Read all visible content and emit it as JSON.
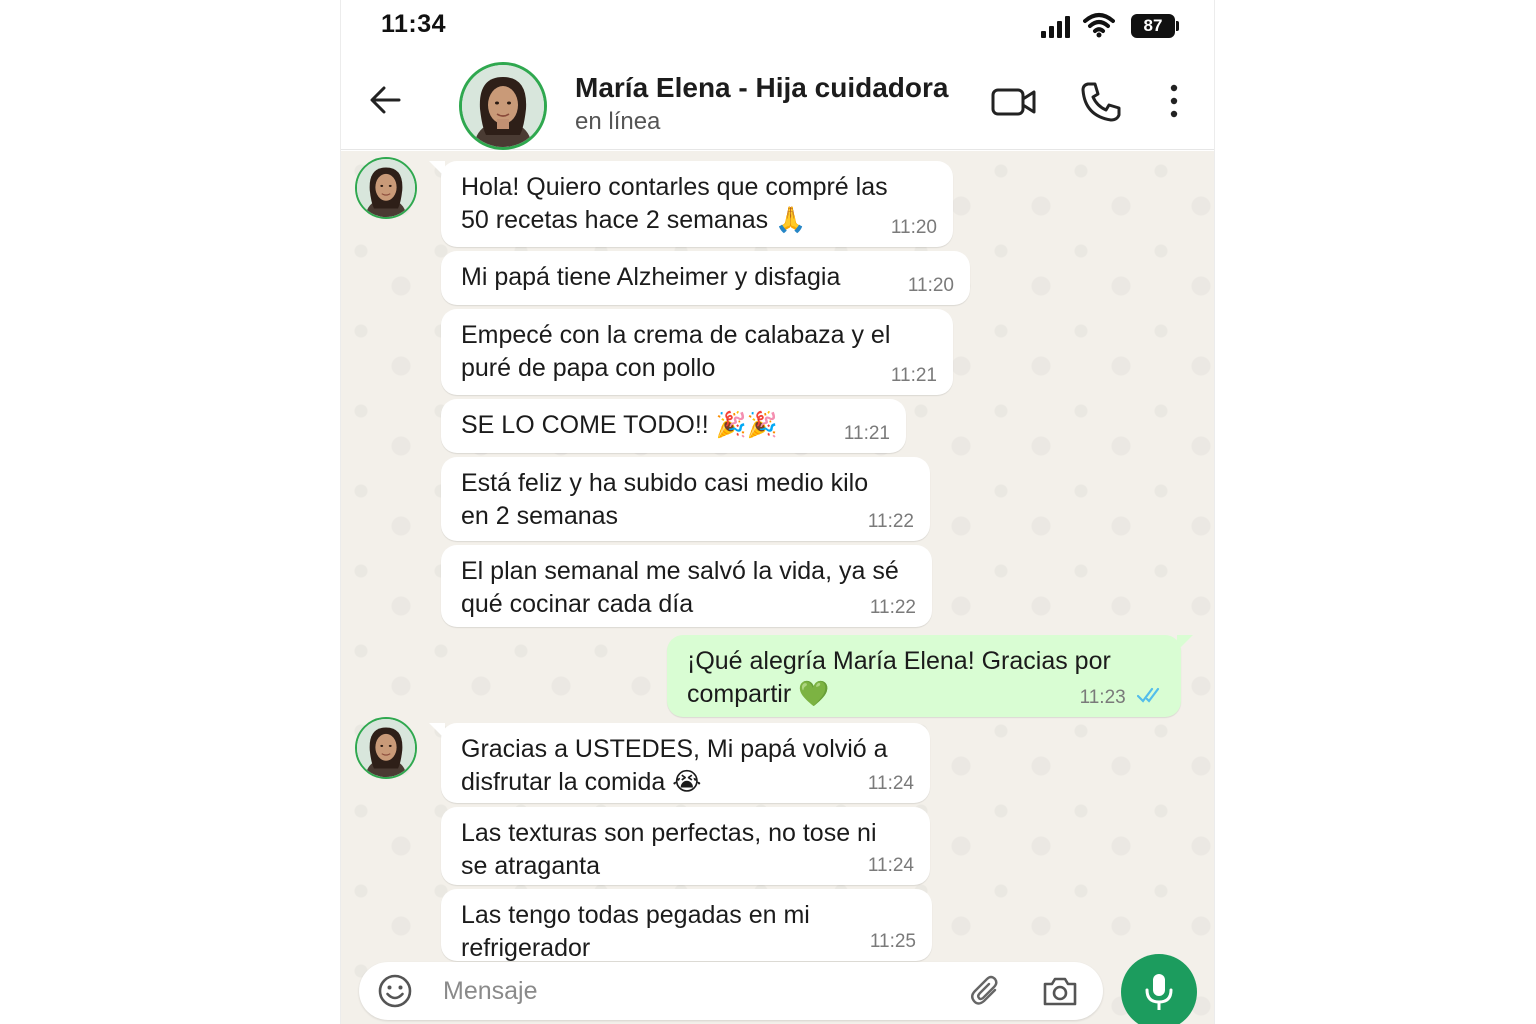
{
  "status_bar": {
    "time": "11:34",
    "battery": "87"
  },
  "header": {
    "contact_name": "María Elena - Hija cuidadora",
    "contact_status": "en línea",
    "icons": [
      "back-arrow-icon",
      "video-call-icon",
      "phone-icon",
      "more-vert-icon"
    ]
  },
  "messages": [
    {
      "dir": "in",
      "text": "Hola! Quiero contarles que compré las\n50 recetas hace 2 semanas 🙏",
      "time": "11:20"
    },
    {
      "dir": "in",
      "text": "Mi papá tiene Alzheimer y disfagia",
      "time": "11:20"
    },
    {
      "dir": "in",
      "text": "Empecé con la crema de calabaza y el\npuré de papa con pollo",
      "time": "11:21"
    },
    {
      "dir": "in",
      "text": "SE LO COME TODO!! 🎉🎉",
      "time": "11:21"
    },
    {
      "dir": "in",
      "text": "Está feliz y ha subido casi medio kilo\nen 2 semanas",
      "time": "11:22"
    },
    {
      "dir": "in",
      "text": "El plan semanal me salvó la vida, ya sé\nqué cocinar cada día",
      "time": "11:22"
    },
    {
      "dir": "out",
      "text": "¡Qué alegría María Elena! Gracias por\ncompartir 💚",
      "time": "11:23",
      "read": true
    },
    {
      "dir": "in",
      "text": "Gracias a USTEDES, Mi papá volvió a\ndisfrutar la comida 😭",
      "time": "11:24"
    },
    {
      "dir": "in",
      "text": "Las texturas son perfectas, no tose ni\nse atraganta",
      "time": "11:24"
    },
    {
      "dir": "in",
      "text": "Las tengo todas pegadas en mi\nrefrigerador",
      "time": "11:25"
    }
  ],
  "input": {
    "placeholder": "Mensaje"
  },
  "colors": {
    "accent": "#1c9c5e",
    "outgoing_bubble": "#d9fdd3",
    "chat_bg": "#f3f0ea",
    "read_ticks": "#53bdeb"
  }
}
